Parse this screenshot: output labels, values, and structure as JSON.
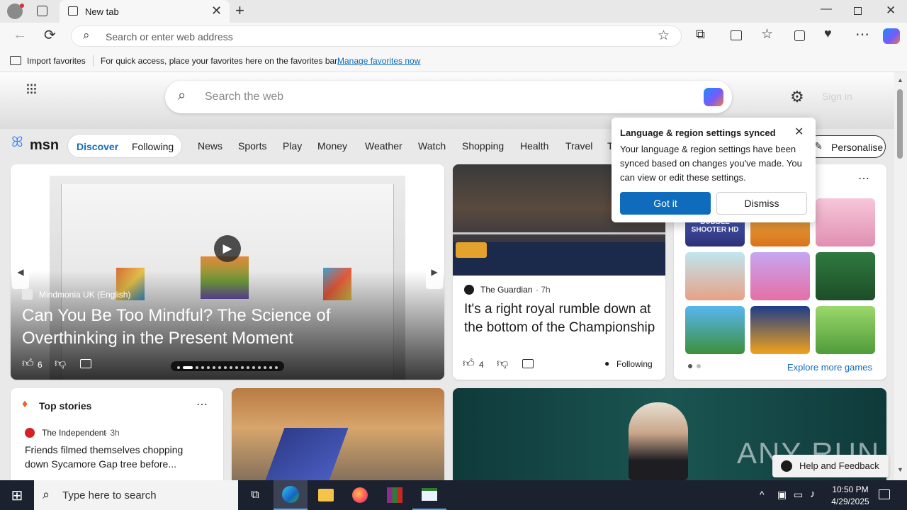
{
  "browser": {
    "tab_title": "New tab",
    "address_placeholder": "Search or enter web address",
    "favorites": {
      "import_label": "Import favorites",
      "hint": "For quick access, place your favorites here on the favorites bar.",
      "manage_link": "Manage favorites now"
    }
  },
  "msn": {
    "search_placeholder": "Search the web",
    "sign_in": "Sign in",
    "logo": "msn",
    "tabs": [
      "Discover",
      "Following"
    ],
    "nav": [
      "News",
      "Sports",
      "Play",
      "Money",
      "Weather",
      "Watch",
      "Shopping",
      "Health",
      "Travel",
      "T"
    ],
    "personalise": "Personalise"
  },
  "popup": {
    "title": "Language & region settings synced",
    "body": "Your language & region settings have been synced based on changes you've made. You can view or edit these settings.",
    "got_it": "Got it",
    "dismiss": "Dismiss"
  },
  "hero": {
    "source": "Mindmonia UK (English)",
    "headline": "Can You Be Too Mindful? The Science of Overthinking in the Present Moment",
    "likes": "6"
  },
  "story2": {
    "source": "The Guardian",
    "age": "7h",
    "headline": "It's a right royal rumble down at the bottom of the Championship",
    "likes": "4",
    "following": "Following"
  },
  "games": {
    "explore": "Explore more games",
    "bubble_text": "BUBBLE SHOOTER HD"
  },
  "top_stories": {
    "title": "Top stories",
    "source": "The Independent",
    "age": "3h",
    "headline": "Friends filmed themselves chopping down Sycamore Gap tree before..."
  },
  "watermark": "ANY RUN",
  "help": "Help and Feedback",
  "taskbar": {
    "search_placeholder": "Type here to search",
    "time": "10:50 PM",
    "date": "4/29/2025"
  }
}
